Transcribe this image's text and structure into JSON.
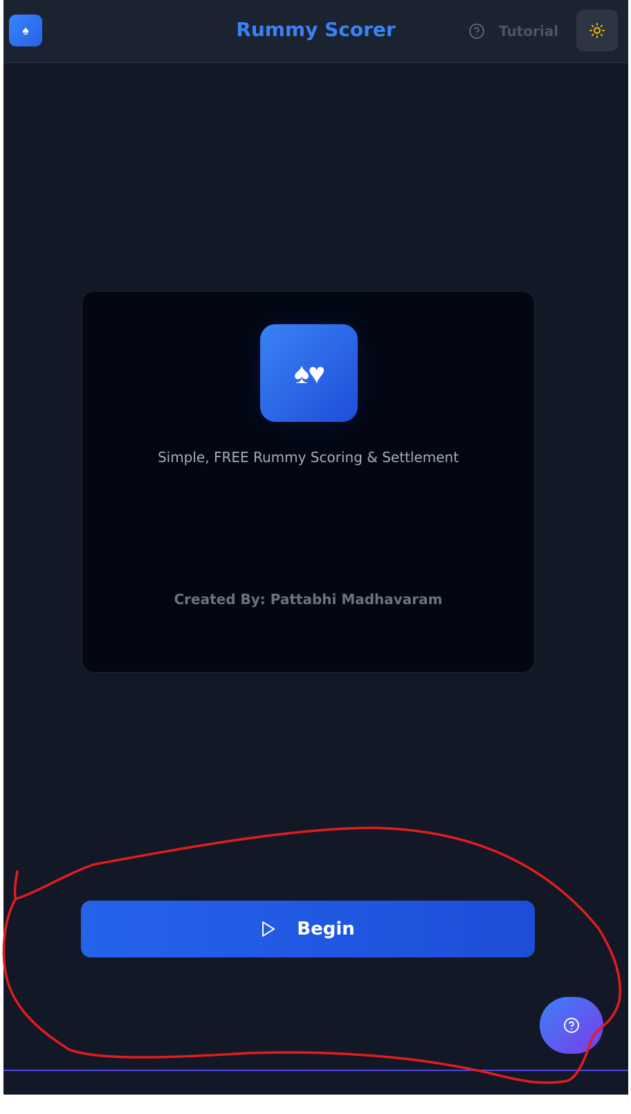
{
  "header": {
    "title": "Rummy Scorer",
    "logo_glyph": "♠",
    "tutorial_label": "Tutorial"
  },
  "card": {
    "logo_glyph": "♠♥",
    "tagline": "Simple, FREE Rummy Scoring & Settlement",
    "credit": "Created By: Pattabhi Madhavaram"
  },
  "actions": {
    "begin_label": "Begin"
  },
  "icons": {
    "logo": "spade-icon",
    "tutorial": "help-circle-icon",
    "theme": "sun-icon",
    "begin": "play-icon",
    "fab": "help-circle-icon"
  },
  "colors": {
    "background": "#121826",
    "header": "#1b2230",
    "accent": "#3b82f6",
    "card": "#030712",
    "sun": "#f5b700",
    "annotation": "#e11d1d"
  }
}
